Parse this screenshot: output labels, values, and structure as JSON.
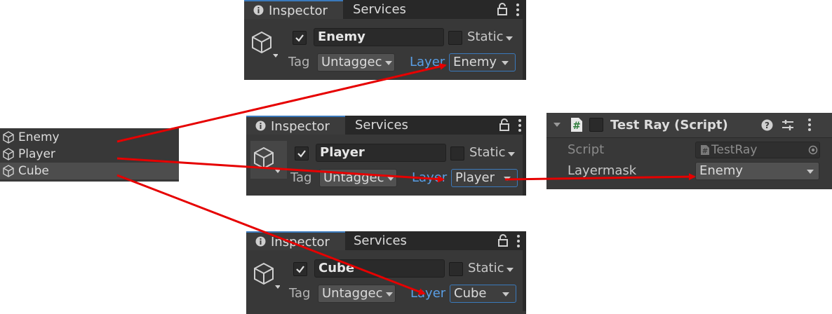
{
  "hierarchy": {
    "items": [
      {
        "label": "Enemy",
        "selected": false
      },
      {
        "label": "Player",
        "selected": false
      },
      {
        "label": "Cube",
        "selected": true
      }
    ]
  },
  "inspectors": [
    {
      "tab_inspector": "Inspector",
      "tab_services": "Services",
      "name": "Enemy",
      "static_label": "Static",
      "tag_label": "Tag",
      "tag_value": "Untaggec",
      "layer_label": "Layer",
      "layer_value": "Enemy"
    },
    {
      "tab_inspector": "Inspector",
      "tab_services": "Services",
      "name": "Player",
      "static_label": "Static",
      "tag_label": "Tag",
      "tag_value": "Untaggec",
      "layer_label": "Layer",
      "layer_value": "Player"
    },
    {
      "tab_inspector": "Inspector",
      "tab_services": "Services",
      "name": "Cube",
      "static_label": "Static",
      "tag_label": "Tag",
      "tag_value": "Untaggec",
      "layer_label": "Layer",
      "layer_value": "Cube"
    }
  ],
  "script_component": {
    "title": "Test Ray (Script)",
    "script_label": "Script",
    "script_value": "TestRay",
    "layermask_label": "Layermask",
    "layermask_value": "Enemy"
  },
  "colors": {
    "panel_bg": "#383838",
    "tab_bar_bg": "#282828",
    "accent_blue": "#3a79bb",
    "layer_label_blue": "#5a9fe6",
    "annotation_arrow": "#e60000"
  },
  "icons": [
    "gameobject-cube-icon",
    "lock-icon",
    "kebab-menu-icon",
    "info-icon",
    "checkmark-icon",
    "script-hash-icon",
    "help-icon",
    "preset-settings-icon",
    "foldout-arrow-icon",
    "object-picker-icon"
  ]
}
